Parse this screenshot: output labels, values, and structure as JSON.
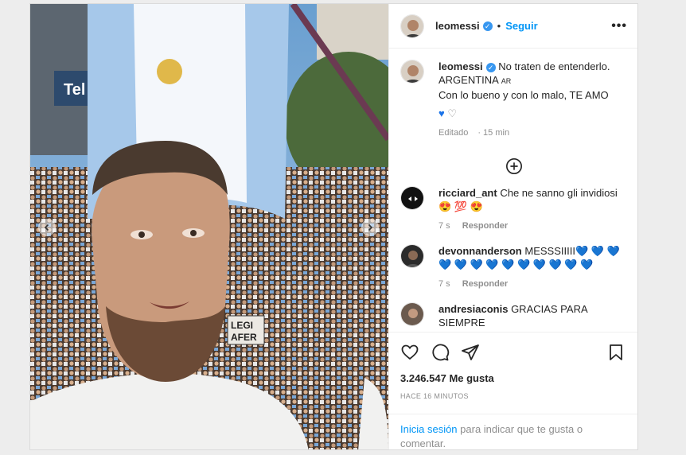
{
  "header": {
    "username": "leomessi",
    "follow_label": "Seguir",
    "dot": "•",
    "more_icon": "•••"
  },
  "caption": {
    "username": "leomessi",
    "line1": "No traten de entenderlo.",
    "line2": "ARGENTINA",
    "flag_code": "AR",
    "line3": "Con lo bueno y con lo malo, TE AMO",
    "hearts_blue": "♥",
    "hearts_outline": "♡",
    "edited": "Editado",
    "time": "15 min"
  },
  "comments": [
    {
      "username": "ricciard_ant",
      "text": "Che ne sanno gli invidiosi",
      "emojis": "😍 💯 😍",
      "time": "7 s",
      "reply_label": "Responder"
    },
    {
      "username": "devonnanderson",
      "text": "MESSSIIIII",
      "hearts": "💙 💙 💙 💙 💙 💙 💙 💙 💙 💙 💙 💙 💙",
      "time": "7 s",
      "reply_label": "Responder"
    },
    {
      "username": "andresiaconis",
      "text": "GRACIAS PARA SIEMPRE"
    }
  ],
  "photo": {
    "banner_text": "Tel",
    "sign_text_1": "LEGI",
    "sign_text_2": "AFER"
  },
  "stats": {
    "likes": "3.246.547 Me gusta",
    "posted": "HACE 16 MINUTOS"
  },
  "login": {
    "link": "Inicia sesión",
    "rest": " para indicar que te gusta o comentar."
  },
  "colors": {
    "accent": "#0095f6",
    "verified": "#3897f0",
    "flag_blue": "#a6c8ea"
  }
}
